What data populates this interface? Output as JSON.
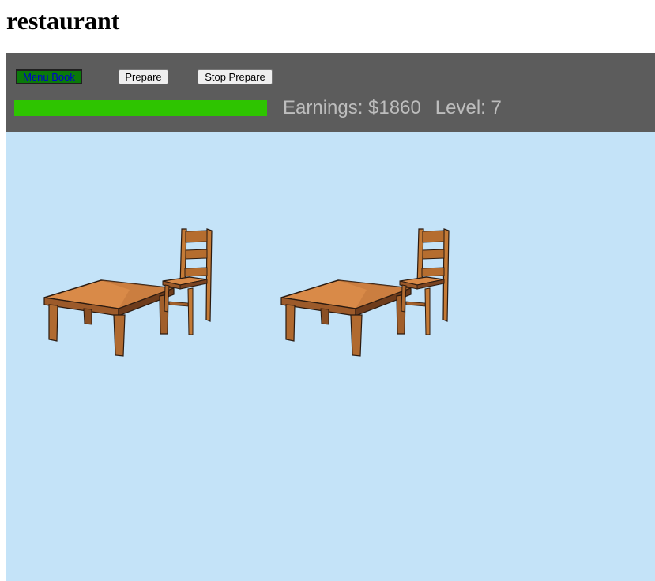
{
  "page": {
    "title": "restaurant"
  },
  "toolbar": {
    "menu_book_label": "Menu Book",
    "prepare_label": "Prepare",
    "stop_prepare_label": "Stop Prepare",
    "progress": 1.0,
    "earnings_text": "Earnings: $1860",
    "level_text": "Level: 7"
  },
  "colors": {
    "toolbar_bg": "#5c5c5c",
    "progress": "#2ec400",
    "floor": "#c4e3f8",
    "menu_button": "#0a7a0a"
  },
  "floor": {
    "sets": [
      {
        "table_icon": "table-icon",
        "chair_icon": "chair-icon"
      },
      {
        "table_icon": "table-icon",
        "chair_icon": "chair-icon"
      }
    ]
  }
}
